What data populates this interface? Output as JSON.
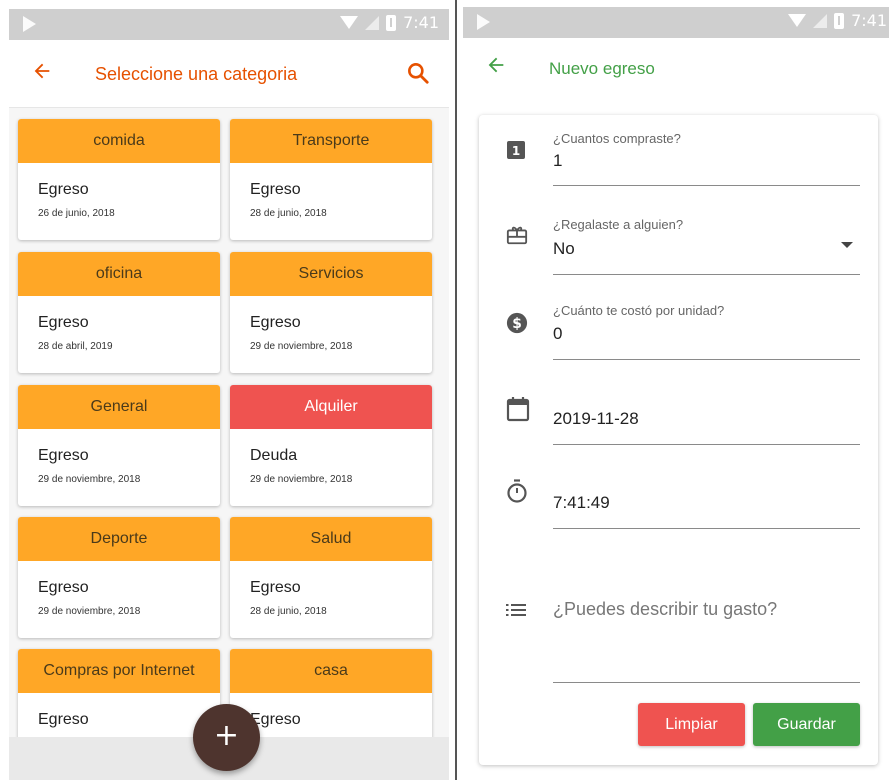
{
  "status_bar": {
    "time": "7:41"
  },
  "colors": {
    "orange": "#FFA726",
    "red_card": "#EF5350",
    "appbar_orange": "#E65100",
    "green": "#43A047",
    "fab": "#4E342E",
    "danger_button": "#EF5350"
  },
  "categories_screen": {
    "title": "Seleccione una categoria",
    "back_icon": "arrow-left-icon",
    "search_icon": "search-icon",
    "fab_label": "+",
    "cards": [
      {
        "name": "comida",
        "kind": "Egreso",
        "date": "26 de junio, 2018",
        "color": "#FFA726"
      },
      {
        "name": "Transporte",
        "kind": "Egreso",
        "date": "28 de junio, 2018",
        "color": "#FFA726"
      },
      {
        "name": "oficina",
        "kind": "Egreso",
        "date": "28 de abril, 2019",
        "color": "#FFA726"
      },
      {
        "name": "Servicios",
        "kind": "Egreso",
        "date": "29 de noviembre, 2018",
        "color": "#FFA726"
      },
      {
        "name": "General",
        "kind": "Egreso",
        "date": "29 de noviembre, 2018",
        "color": "#FFA726"
      },
      {
        "name": "Alquiler",
        "kind": "Deuda",
        "date": "29 de noviembre, 2018",
        "color": "#EF5350"
      },
      {
        "name": "Deporte",
        "kind": "Egreso",
        "date": "29 de noviembre, 2018",
        "color": "#FFA726"
      },
      {
        "name": "Salud",
        "kind": "Egreso",
        "date": "28 de junio, 2018",
        "color": "#FFA726"
      },
      {
        "name": "Compras por Internet",
        "kind": "Egreso",
        "date": "",
        "color": "#FFA726"
      },
      {
        "name": "casa",
        "kind": "Egreso",
        "date": "",
        "color": "#FFA726"
      }
    ]
  },
  "expense_screen": {
    "title": "Nuevo egreso",
    "quantity": {
      "label": "¿Cuantos compraste?",
      "value": "1"
    },
    "gift": {
      "label": "¿Regalaste a alguien?",
      "value": "No"
    },
    "unit_cost": {
      "label": "¿Cuánto te costó por unidad?",
      "value": "0"
    },
    "date": {
      "value": "2019-11-28"
    },
    "time": {
      "value": "7:41:49"
    },
    "description": {
      "placeholder": "¿Puedes describir tu gasto?"
    },
    "clear_label": "Limpiar",
    "save_label": "Guardar"
  }
}
